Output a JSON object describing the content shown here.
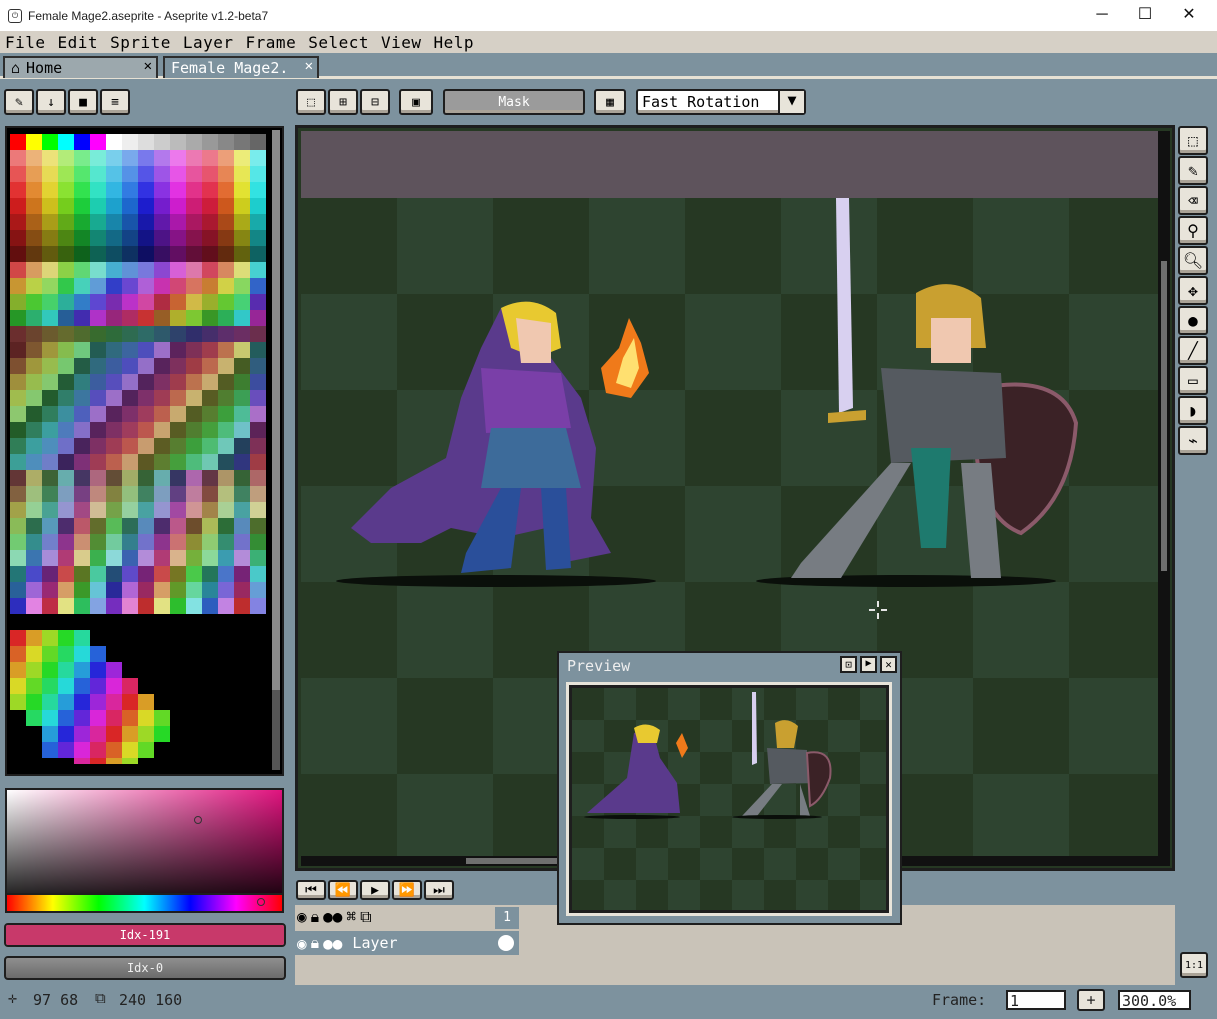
{
  "window": {
    "title": "Female Mage2.aseprite - Aseprite v1.2-beta7",
    "app_icon": "aseprite-icon",
    "minimize": "─",
    "maximize": "☐",
    "close": "✕"
  },
  "menu": {
    "items": [
      "File",
      "Edit",
      "Sprite",
      "Layer",
      "Frame",
      "Select",
      "View",
      "Help"
    ]
  },
  "tabs": [
    {
      "label": "Home",
      "icon": "home-icon",
      "close": "✕"
    },
    {
      "label": "Female Mage2.",
      "close": "✕",
      "active": true
    }
  ],
  "toolbar": {
    "mask_label": "Mask",
    "rotation_algorithm": "Fast Rotation"
  },
  "color_bar": {
    "fg_label": "Idx-191",
    "bg_label": "Idx-0",
    "fg_color": "#c8396a",
    "bg_color": "#000000"
  },
  "status": {
    "cursor": "97 68",
    "size": "240 160",
    "frame_label": "Frame:",
    "frame_value": "1",
    "add_frame": "+",
    "zoom": "300.0%"
  },
  "timeline": {
    "frame_number": "1",
    "layer_name": "Layer"
  },
  "preview": {
    "title": "Preview"
  },
  "canvas": {
    "bg_dark": "#263823",
    "bg_light": "#2e4430",
    "sky": "#5e535c"
  },
  "zoom_button": "1:1"
}
